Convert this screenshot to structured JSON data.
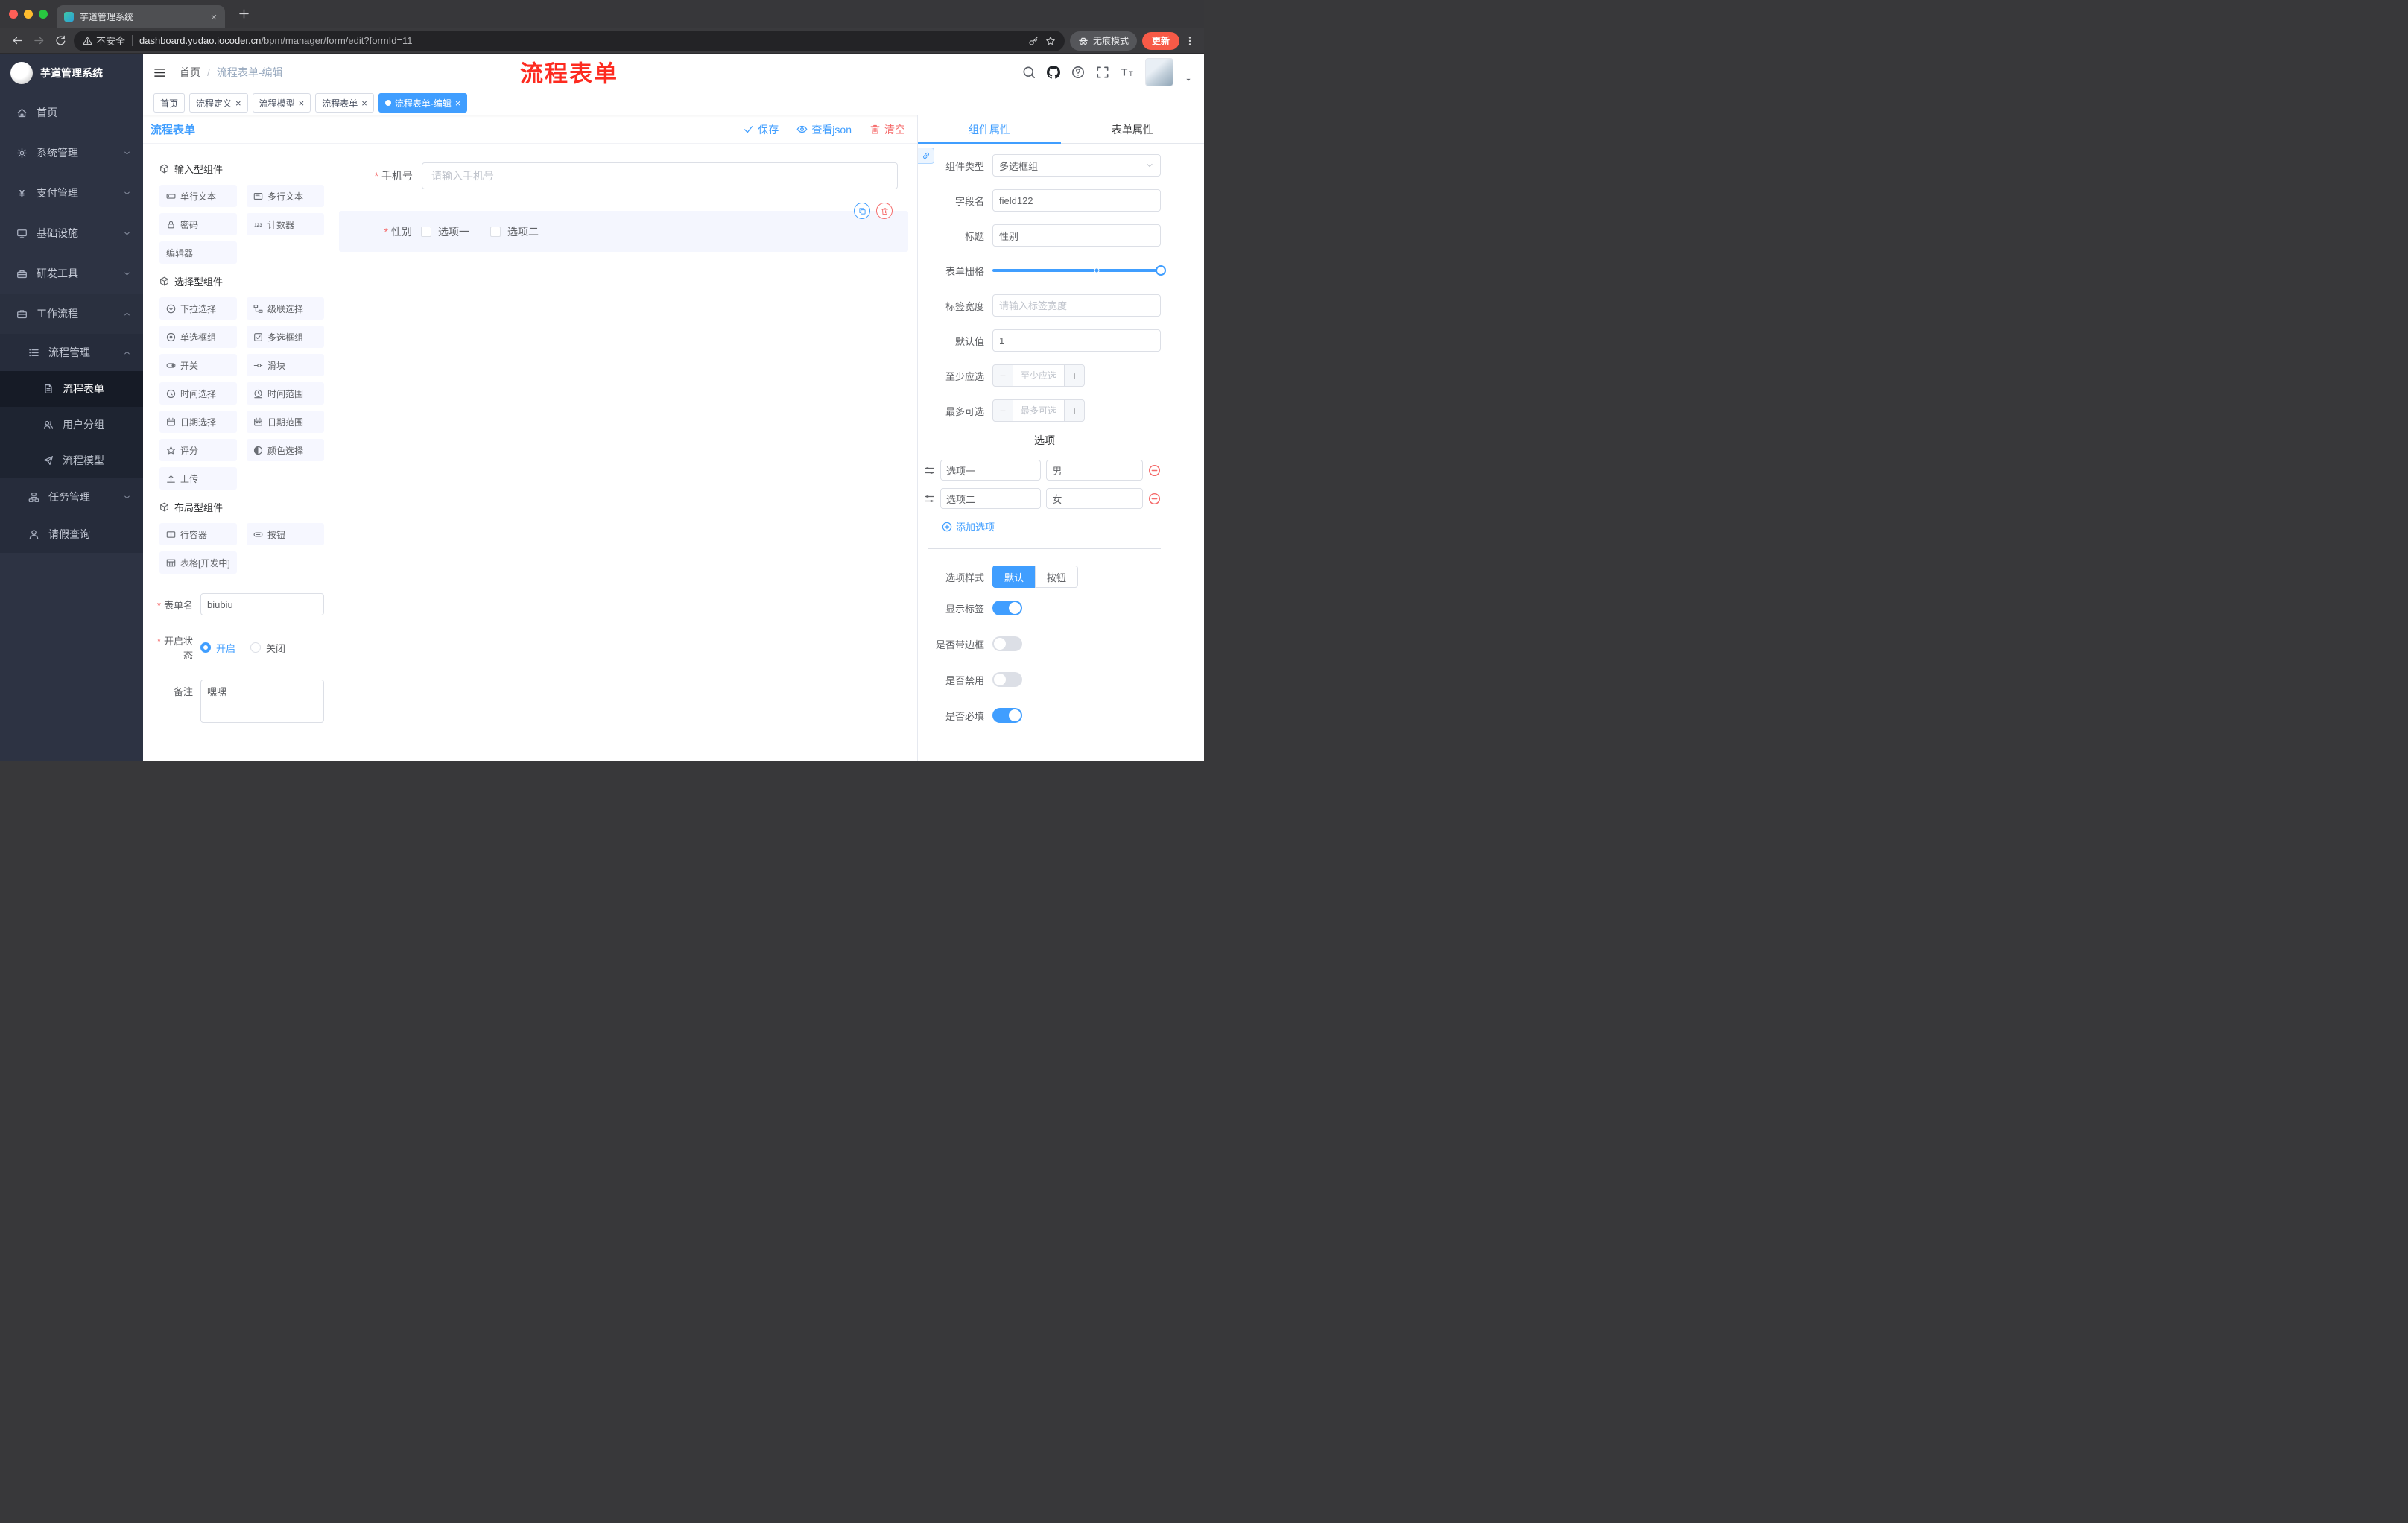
{
  "colors": {
    "accent": "#409eff",
    "danger": "#f56c6c",
    "annotation_red": "#fd2b20",
    "update_pill": "#f75a47"
  },
  "browser": {
    "tab_title": "芋道管理系统",
    "security_label": "不安全",
    "url_domain": "dashboard.yudao.iocoder.cn",
    "url_path": "/bpm/manager/form/edit?formId=11",
    "incognito_label": "无痕模式",
    "update_label": "更新"
  },
  "sidebar": {
    "logo_title": "芋道管理系统",
    "items": [
      {
        "label": "首页",
        "icon": "home-icon"
      },
      {
        "label": "系统管理",
        "icon": "gear-icon"
      },
      {
        "label": "支付管理",
        "icon": "yen-icon"
      },
      {
        "label": "基础设施",
        "icon": "monitor-icon"
      },
      {
        "label": "研发工具",
        "icon": "toolbox-icon"
      },
      {
        "label": "工作流程",
        "icon": "briefcase-icon"
      }
    ],
    "process_group": {
      "label": "流程管理",
      "icon": "list-icon"
    },
    "process_children": [
      {
        "label": "流程表单",
        "icon": "doc-icon",
        "active": true
      },
      {
        "label": "用户分组",
        "icon": "users-icon"
      },
      {
        "label": "流程模型",
        "icon": "send-icon"
      }
    ],
    "task_group": {
      "label": "任务管理",
      "icon": "tasks-icon"
    },
    "leave_item": {
      "label": "请假查询",
      "icon": "user-icon"
    }
  },
  "header": {
    "breadcrumb_home": "首页",
    "breadcrumb_current": "流程表单-编辑",
    "annotation": "流程表单"
  },
  "tags": [
    {
      "label": "首页",
      "closable": false,
      "active": false
    },
    {
      "label": "流程定义",
      "closable": true,
      "active": false
    },
    {
      "label": "流程模型",
      "closable": true,
      "active": false
    },
    {
      "label": "流程表单",
      "closable": true,
      "active": false
    },
    {
      "label": "流程表单-编辑",
      "closable": true,
      "active": true
    }
  ],
  "toolbar": {
    "title": "流程表单",
    "save": "保存",
    "view_json": "查看json",
    "clear": "清空"
  },
  "palette": {
    "sections": [
      {
        "title": "输入型组件"
      },
      {
        "title": "选择型组件"
      },
      {
        "title": "布局型组件"
      }
    ],
    "input_items": [
      {
        "label": "单行文本",
        "icon": "input-icon"
      },
      {
        "label": "多行文本",
        "icon": "textarea-icon"
      },
      {
        "label": "密码",
        "icon": "lock-icon"
      },
      {
        "label": "计数器",
        "icon": "counter-icon"
      },
      {
        "label": "编辑器",
        "icon": ""
      }
    ],
    "select_items": [
      {
        "label": "下拉选择",
        "icon": "select-icon"
      },
      {
        "label": "级联选择",
        "icon": "cascade-icon"
      },
      {
        "label": "单选框组",
        "icon": "radio-icon"
      },
      {
        "label": "多选框组",
        "icon": "checkbox-icon"
      },
      {
        "label": "开关",
        "icon": "switch-icon"
      },
      {
        "label": "滑块",
        "icon": "slider-icon"
      },
      {
        "label": "时间选择",
        "icon": "time-icon"
      },
      {
        "label": "时间范围",
        "icon": "time-range-icon"
      },
      {
        "label": "日期选择",
        "icon": "date-icon"
      },
      {
        "label": "日期范围",
        "icon": "date-range-icon"
      },
      {
        "label": "评分",
        "icon": "star-icon"
      },
      {
        "label": "颜色选择",
        "icon": "color-icon"
      },
      {
        "label": "上传",
        "icon": "upload-icon"
      }
    ],
    "layout_items": [
      {
        "label": "行容器",
        "icon": "row-icon"
      },
      {
        "label": "按钮",
        "icon": "button-icon"
      },
      {
        "label": "表格[开发中]",
        "icon": "table-icon"
      }
    ]
  },
  "left_form": {
    "form_name_label": "表单名",
    "form_name_value": "biubiu",
    "status_label": "开启状态",
    "status_on": "开启",
    "status_off": "关闭",
    "remark_label": "备注",
    "remark_value": "嘿嘿"
  },
  "canvas": {
    "phone_label": "手机号",
    "phone_placeholder": "请输入手机号",
    "gender_label": "性别",
    "gender_option1": "选项一",
    "gender_option2": "选项二"
  },
  "panel": {
    "tab_component": "组件属性",
    "tab_form": "表单属性",
    "component_type_label": "组件类型",
    "component_type_value": "多选框组",
    "field_name_label": "字段名",
    "field_name_value": "field122",
    "title_label": "标题",
    "title_value": "性别",
    "grid_label": "表单栅格",
    "label_width_label": "标签宽度",
    "label_width_placeholder": "请输入标签宽度",
    "default_label": "默认值",
    "default_value": "1",
    "min_label": "至少应选",
    "min_placeholder": "至少应选",
    "max_label": "最多可选",
    "max_placeholder": "最多可选",
    "options_title": "选项",
    "options": [
      {
        "label": "选项一",
        "value": "男"
      },
      {
        "label": "选项二",
        "value": "女"
      }
    ],
    "add_option": "添加选项",
    "style_label": "选项样式",
    "style_default": "默认",
    "style_button": "按钮",
    "switch_show_label": "显示标签",
    "switch_show_on": true,
    "switch_border_label": "是否带边框",
    "switch_border_on": false,
    "switch_disabled_label": "是否禁用",
    "switch_disabled_on": false,
    "switch_required_label": "是否必填",
    "switch_required_on": true
  }
}
